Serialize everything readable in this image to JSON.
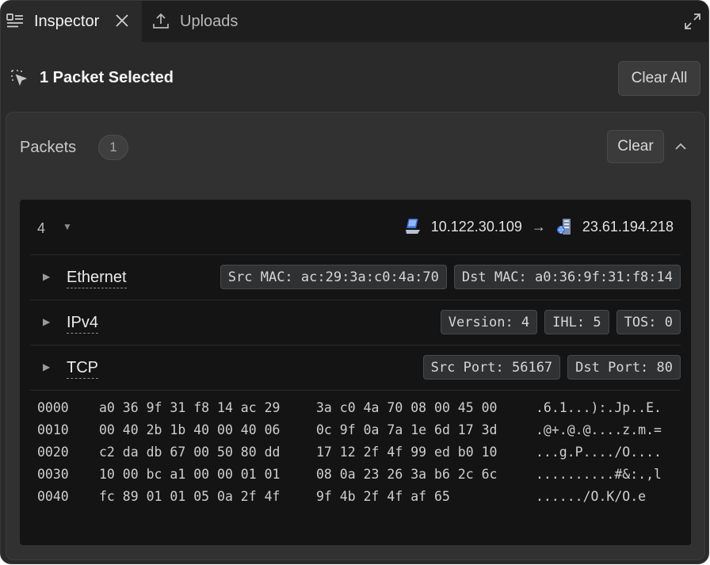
{
  "tabs": [
    {
      "label": "Inspector",
      "icon": "inspector-icon",
      "active": true
    },
    {
      "label": "Uploads",
      "icon": "upload-icon",
      "active": false
    }
  ],
  "selection": {
    "title": "1 Packet Selected",
    "clear_all_label": "Clear All"
  },
  "packets_panel": {
    "title": "Packets",
    "count": "1",
    "clear_label": "Clear"
  },
  "packet": {
    "number": "4",
    "src_ip": "10.122.30.109",
    "arrow": "→",
    "dst_ip": "23.61.194.218",
    "layers": [
      {
        "name": "Ethernet",
        "fields": [
          "Src MAC: ac:29:3a:c0:4a:70",
          "Dst MAC: a0:36:9f:31:f8:14"
        ]
      },
      {
        "name": "IPv4",
        "fields": [
          "Version: 4",
          "IHL: 5",
          "TOS: 0"
        ]
      },
      {
        "name": "TCP",
        "fields": [
          "Src Port: 56167",
          "Dst Port: 80"
        ]
      }
    ],
    "hexdump": [
      {
        "offset": "0000",
        "hex1": "a0 36 9f 31 f8 14 ac 29",
        "hex2": "3a c0 4a 70 08 00 45 00",
        "ascii": ".6.1...):.Jp..E."
      },
      {
        "offset": "0010",
        "hex1": "00 40 2b 1b 40 00 40 06",
        "hex2": "0c 9f 0a 7a 1e 6d 17 3d",
        "ascii": ".@+.@.@....z.m.="
      },
      {
        "offset": "0020",
        "hex1": "c2 da db 67 00 50 80 dd",
        "hex2": "17 12 2f 4f 99 ed b0 10",
        "ascii": "...g.P..../O...."
      },
      {
        "offset": "0030",
        "hex1": "10 00 bc a1 00 00 01 01",
        "hex2": "08 0a 23 26 3a b6 2c 6c",
        "ascii": "..........#&:.,l"
      },
      {
        "offset": "0040",
        "hex1": "fc 89 01 01 05 0a 2f 4f",
        "hex2": "9f 4b 2f 4f af 65",
        "ascii": "....../O.K/O.e"
      }
    ]
  },
  "colors": {
    "window_bg": "#2a2a2b",
    "tabbar_bg": "#1e1e1f",
    "card_bg": "#141415",
    "chip_bg": "#303133"
  }
}
